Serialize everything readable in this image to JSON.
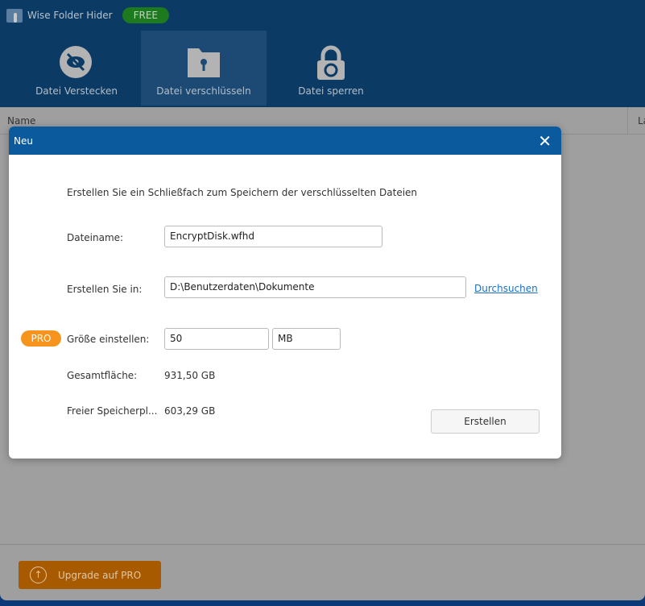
{
  "app": {
    "title": "Wise Folder Hider",
    "badge": "FREE"
  },
  "tabs": [
    {
      "label": "Datei Verstecken",
      "icon": "eye-slash-icon"
    },
    {
      "label": "Datei verschlüsseln",
      "icon": "folder-lock-icon"
    },
    {
      "label": "Datei sperren",
      "icon": "padlock-icon"
    }
  ],
  "columns": [
    "Name",
    "La"
  ],
  "footer": {
    "upgrade_label": "Upgrade auf PRO"
  },
  "dialog": {
    "title": "Neu",
    "intro": "Erstellen Sie ein Schließfach zum Speichern der verschlüsselten Dateien",
    "filename_label": "Dateiname:",
    "filename_value": "EncryptDisk.wfhd",
    "location_label": "Erstellen Sie in:",
    "location_value": "D:\\Benutzerdaten\\Dokumente",
    "browse_label": "Durchsuchen",
    "pro_badge": "PRO",
    "size_label": "Größe einstellen:",
    "size_value": "50",
    "size_unit": "MB",
    "total_label": "Gesamtfläche:",
    "total_value": "931,50 GB",
    "free_label": "Freier Speicherpl...",
    "free_value": "603,29 GB",
    "create_label": "Erstellen"
  }
}
